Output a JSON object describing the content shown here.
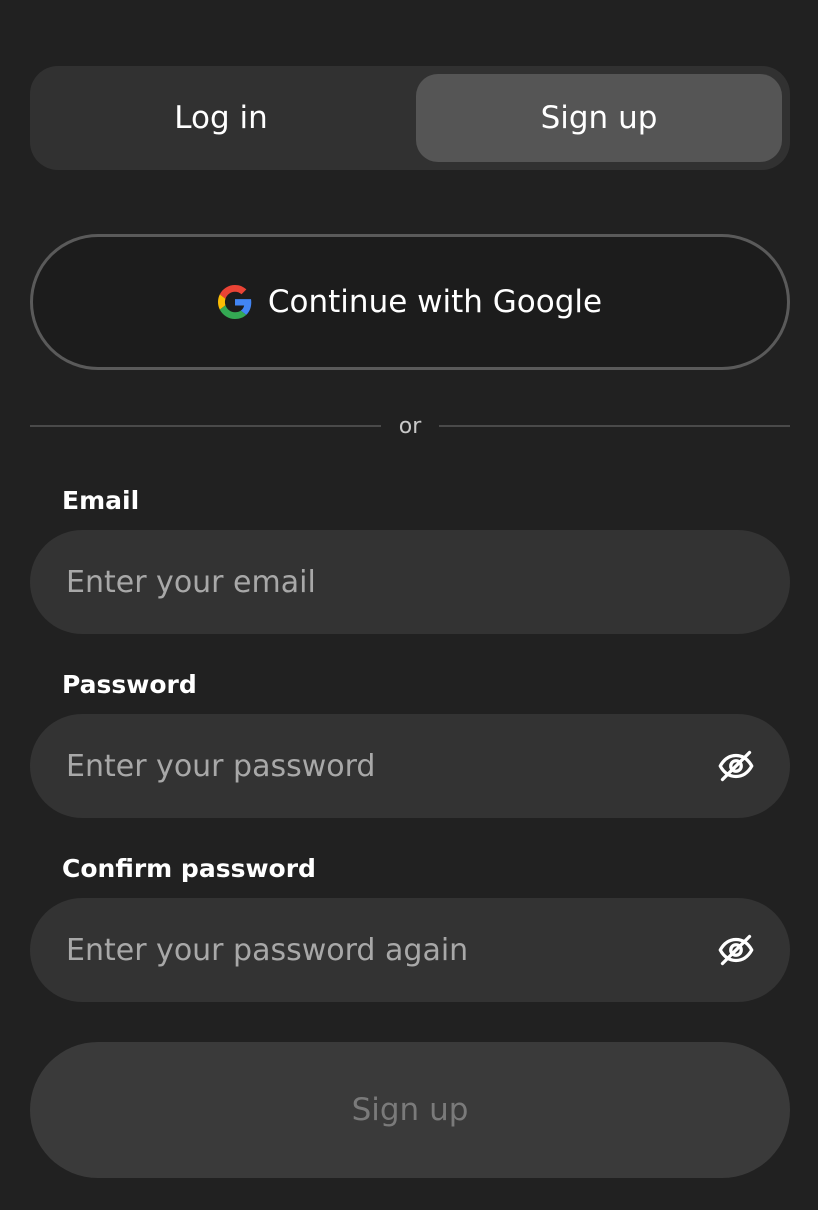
{
  "tabs": {
    "login_label": "Log in",
    "signup_label": "Sign up",
    "active": "signup"
  },
  "google": {
    "label": "Continue with Google",
    "icon": "google-icon"
  },
  "divider": {
    "text": "or"
  },
  "email": {
    "label": "Email",
    "placeholder": "Enter your email",
    "value": ""
  },
  "password": {
    "label": "Password",
    "placeholder": "Enter your password",
    "value": "",
    "toggle_icon": "eye-off-icon"
  },
  "confirm_password": {
    "label": "Confirm password",
    "placeholder": "Enter your password again",
    "value": "",
    "toggle_icon": "eye-off-icon"
  },
  "submit": {
    "label": "Sign up",
    "disabled": true
  },
  "colors": {
    "background": "#212121",
    "tab_container": "#313131",
    "tab_active": "#555555",
    "input_background": "#333333",
    "google_border": "#5a5a5a",
    "submit_background": "#3a3a3a",
    "submit_text_disabled": "#7a7a7a",
    "google_blue": "#4285F4",
    "google_red": "#EA4335",
    "google_yellow": "#FBBC05",
    "google_green": "#34A853"
  }
}
